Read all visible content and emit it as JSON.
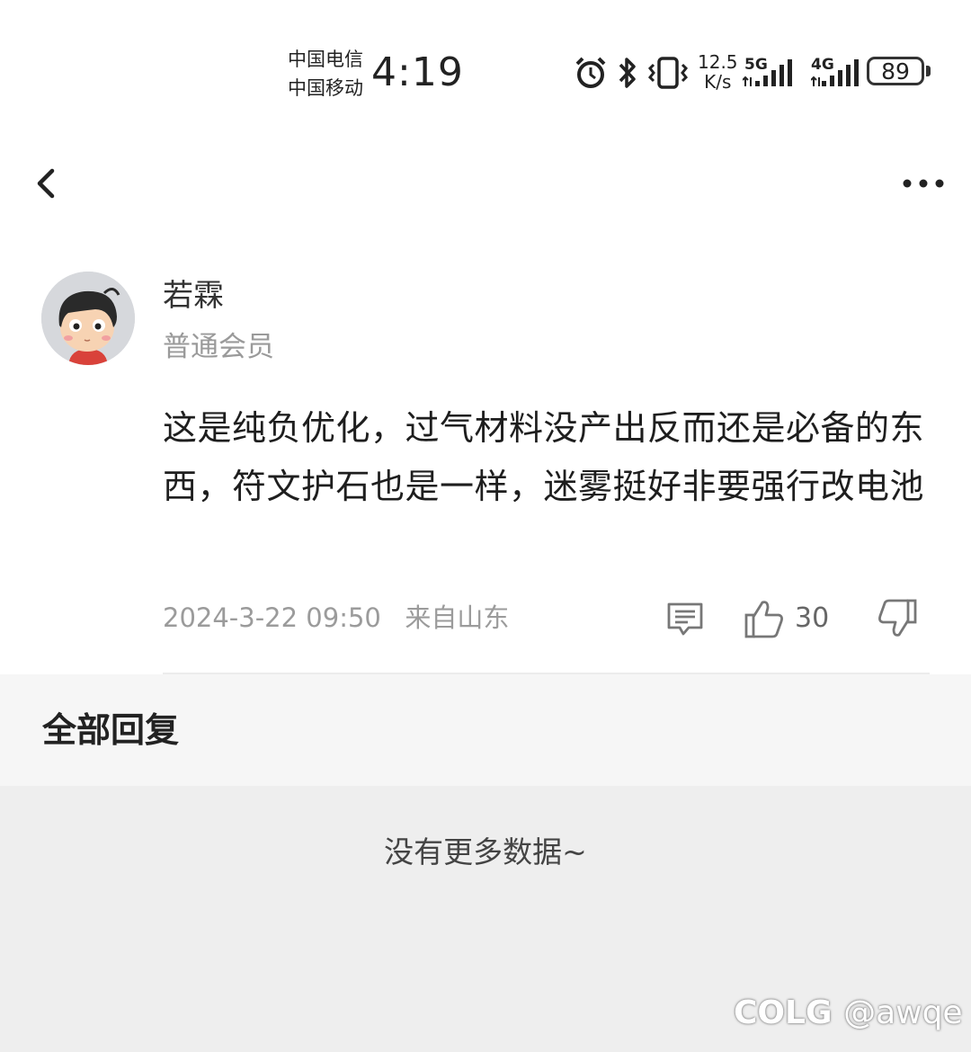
{
  "status_bar": {
    "carrier_1": "中国电信",
    "carrier_2": "中国移动",
    "time": "4:19",
    "speed_value": "12.5",
    "speed_unit": "K/s",
    "network_1": "5G",
    "network_2": "4G",
    "battery": "89"
  },
  "post": {
    "username": "若霖",
    "level": "普通会员",
    "content": "这是纯负优化，过气材料没产出反而还是必备的东西，符文护石也是一样，迷雾挺好非要强行改电池",
    "timestamp": "2024-3-22 09:50",
    "location": "来自山东",
    "like_count": "30"
  },
  "replies": {
    "title": "全部回复",
    "empty_text": "没有更多数据~"
  },
  "watermark": {
    "logo": "COLG",
    "handle": "@awqe"
  }
}
